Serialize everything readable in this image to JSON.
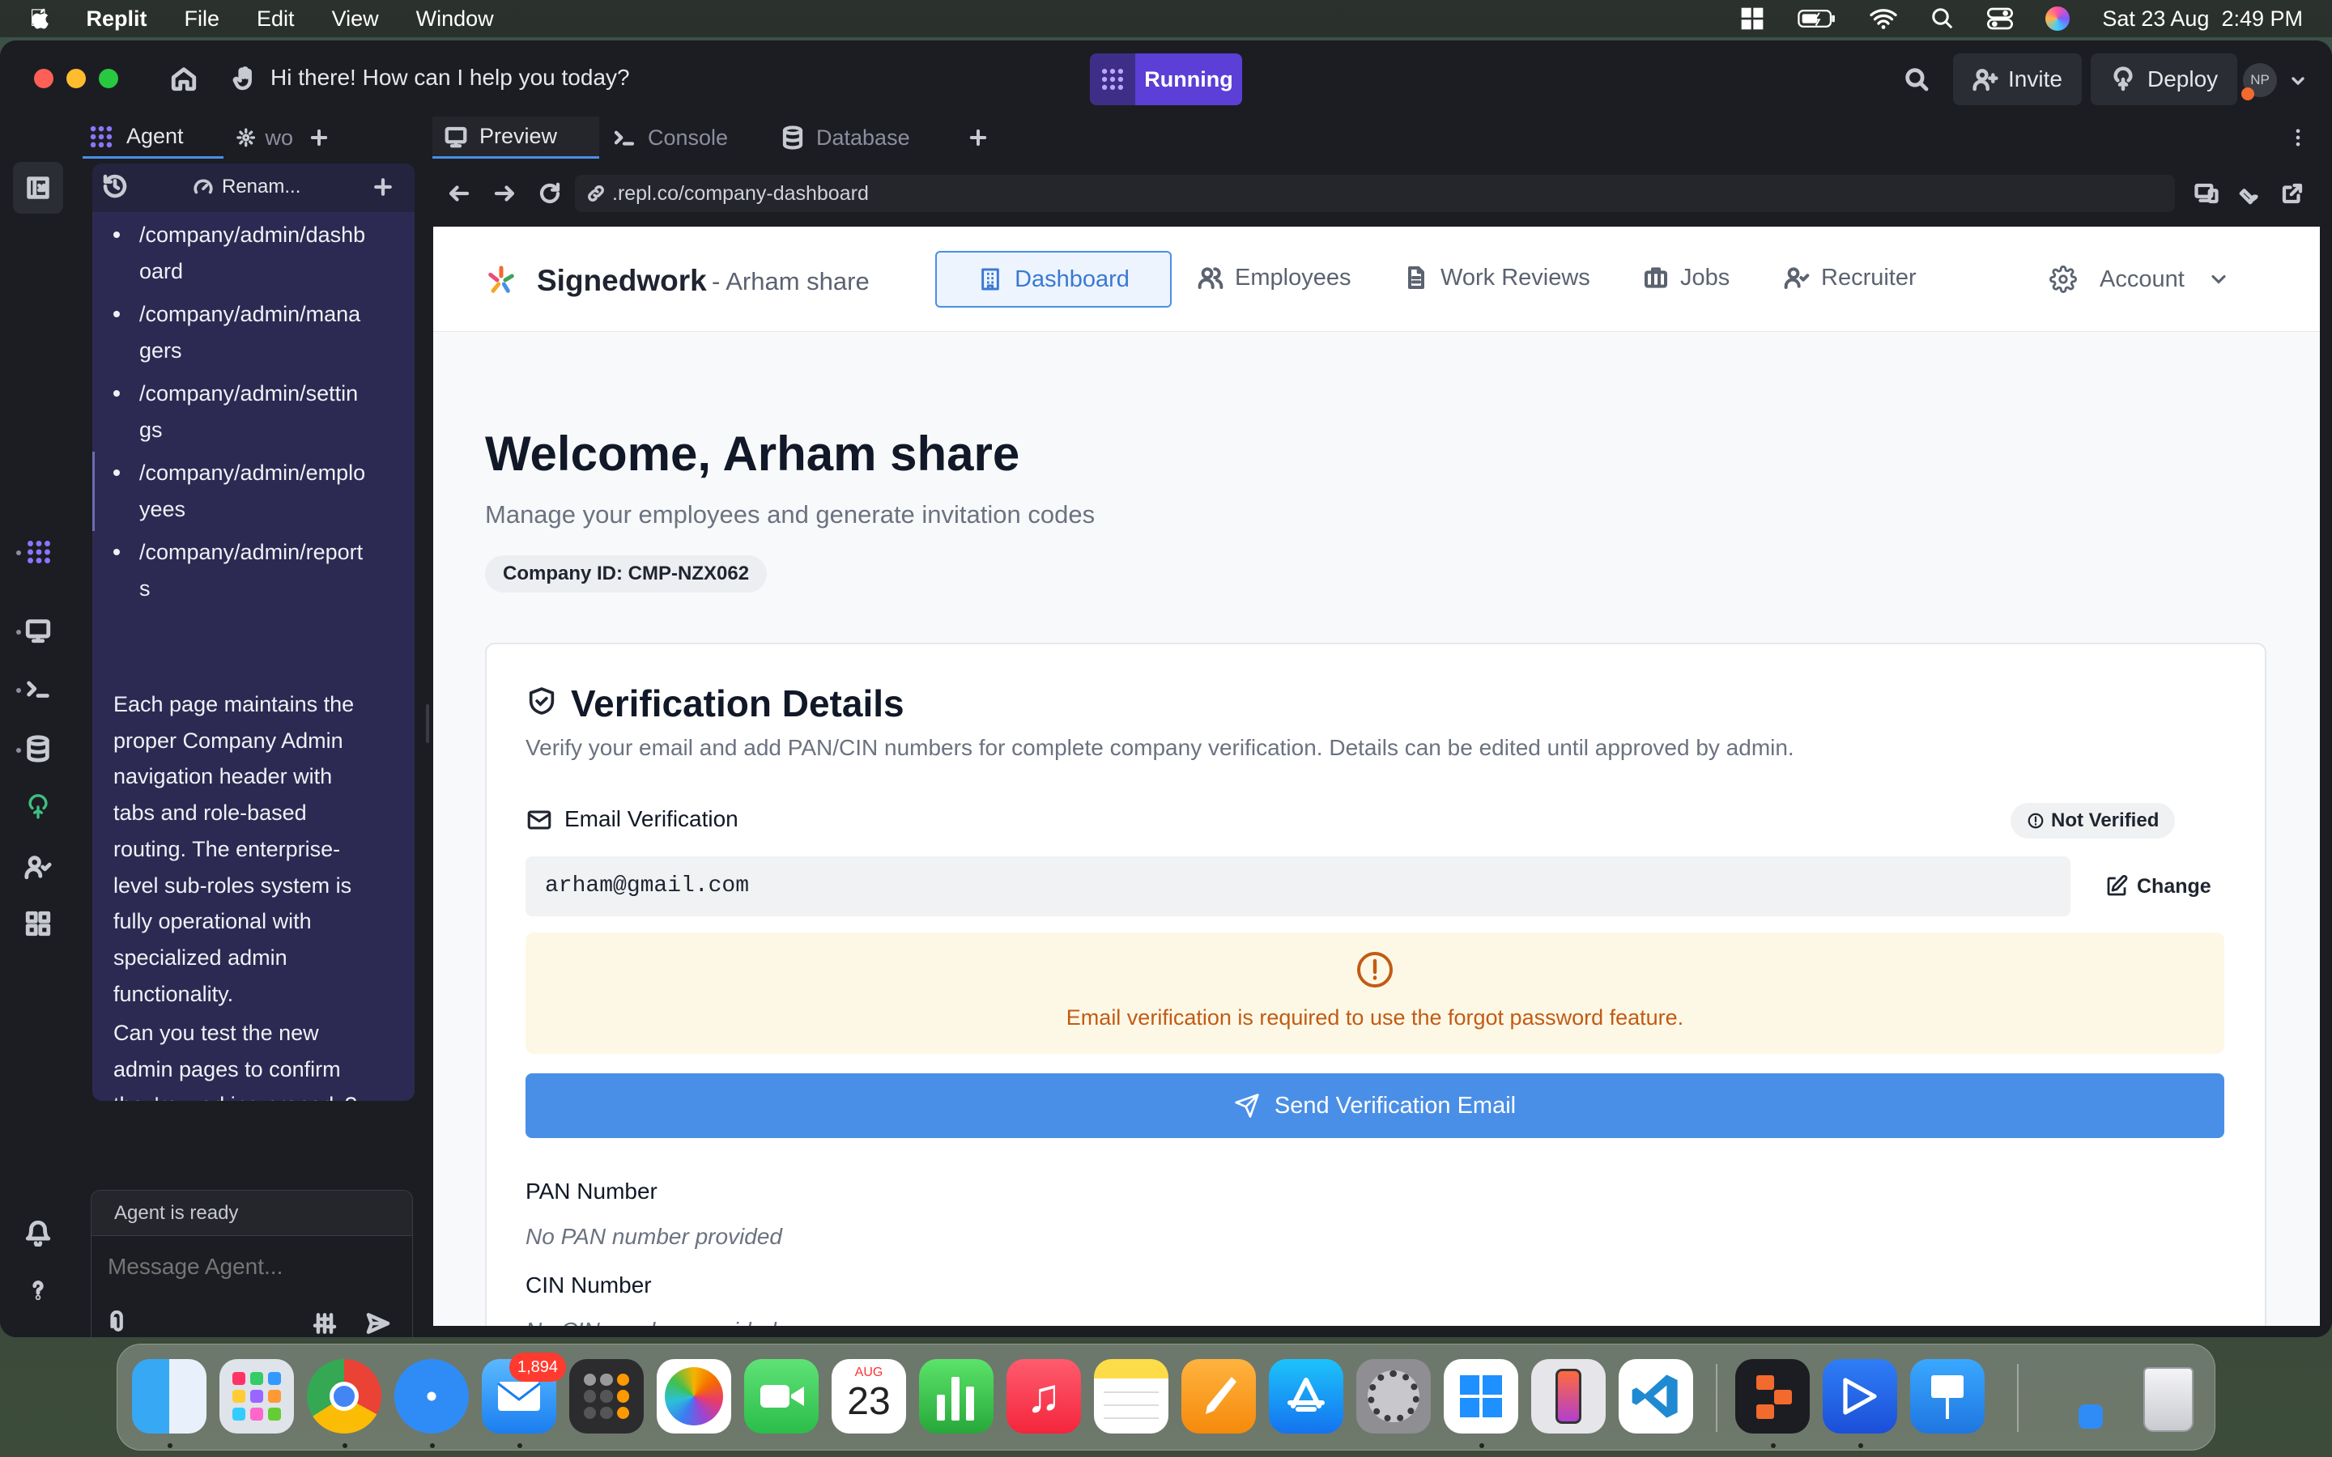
{
  "menubar": {
    "app": "Replit",
    "items": [
      "File",
      "Edit",
      "View",
      "Window"
    ],
    "datetime": "Sat 23 Aug  2:49 PM"
  },
  "titlebar": {
    "prompt": "Hi there! How can I help you today?",
    "status": "Running",
    "invite": "Invite",
    "deploy": "Deploy",
    "avatar": "NP"
  },
  "agent": {
    "tab_agent": "Agent",
    "tab_other": "wo",
    "rename": "Renam...",
    "routes": [
      [
        "/company/admin/dashb",
        "oard"
      ],
      [
        "/company/admin/mana",
        "gers"
      ],
      [
        "/company/admin/settin",
        "gs"
      ],
      [
        "/company/admin/emplo",
        "yees"
      ],
      [
        "/company/admin/report",
        "s"
      ]
    ],
    "para1": [
      "Each page maintains the",
      "proper Company Admin",
      "navigation header with",
      "tabs and role-based",
      "routing. The enterprise-",
      "level sub-roles system is",
      "fully operational with",
      "specialized admin",
      "functionality."
    ],
    "para2": [
      "Can you test the new",
      "admin pages to confirm",
      "they're working properly?"
    ],
    "status": "Agent is ready",
    "input_placeholder": "Message Agent..."
  },
  "workspace": {
    "tabs": [
      "Preview",
      "Console",
      "Database"
    ],
    "url": ".repl.co/company-dashboard"
  },
  "app": {
    "brand": "Signedwork",
    "brand_sub": "- Arham share",
    "nav": [
      "Dashboard",
      "Employees",
      "Work Reviews",
      "Jobs",
      "Recruiter"
    ],
    "account": "Account",
    "welcome": "Welcome, Arham share",
    "subtitle": "Manage your employees and generate invitation codes",
    "company_id": "Company ID: CMP-NZX062",
    "verification": {
      "title": "Verification Details",
      "desc": "Verify your email and add PAN/CIN numbers for complete company verification. Details can be edited until approved by admin.",
      "email_label": "Email Verification",
      "badge": "Not Verified",
      "email_value": "arham@gmail.com",
      "change": "Change",
      "warning": "Email verification is required to use the forgot password feature.",
      "send_button": "Send Verification Email",
      "pan_label": "PAN Number",
      "pan_value": "No PAN number provided",
      "cin_label": "CIN Number",
      "cin_value": "No CIN number provided"
    }
  },
  "dock": {
    "mail_badge": "1,894",
    "cal_month": "AUG",
    "cal_day": "23"
  },
  "colors": {
    "accent": "#4a8fe7",
    "running": "#5b3fd6",
    "warning_bg": "#fdf8e6",
    "warning_text": "#c25b14"
  }
}
